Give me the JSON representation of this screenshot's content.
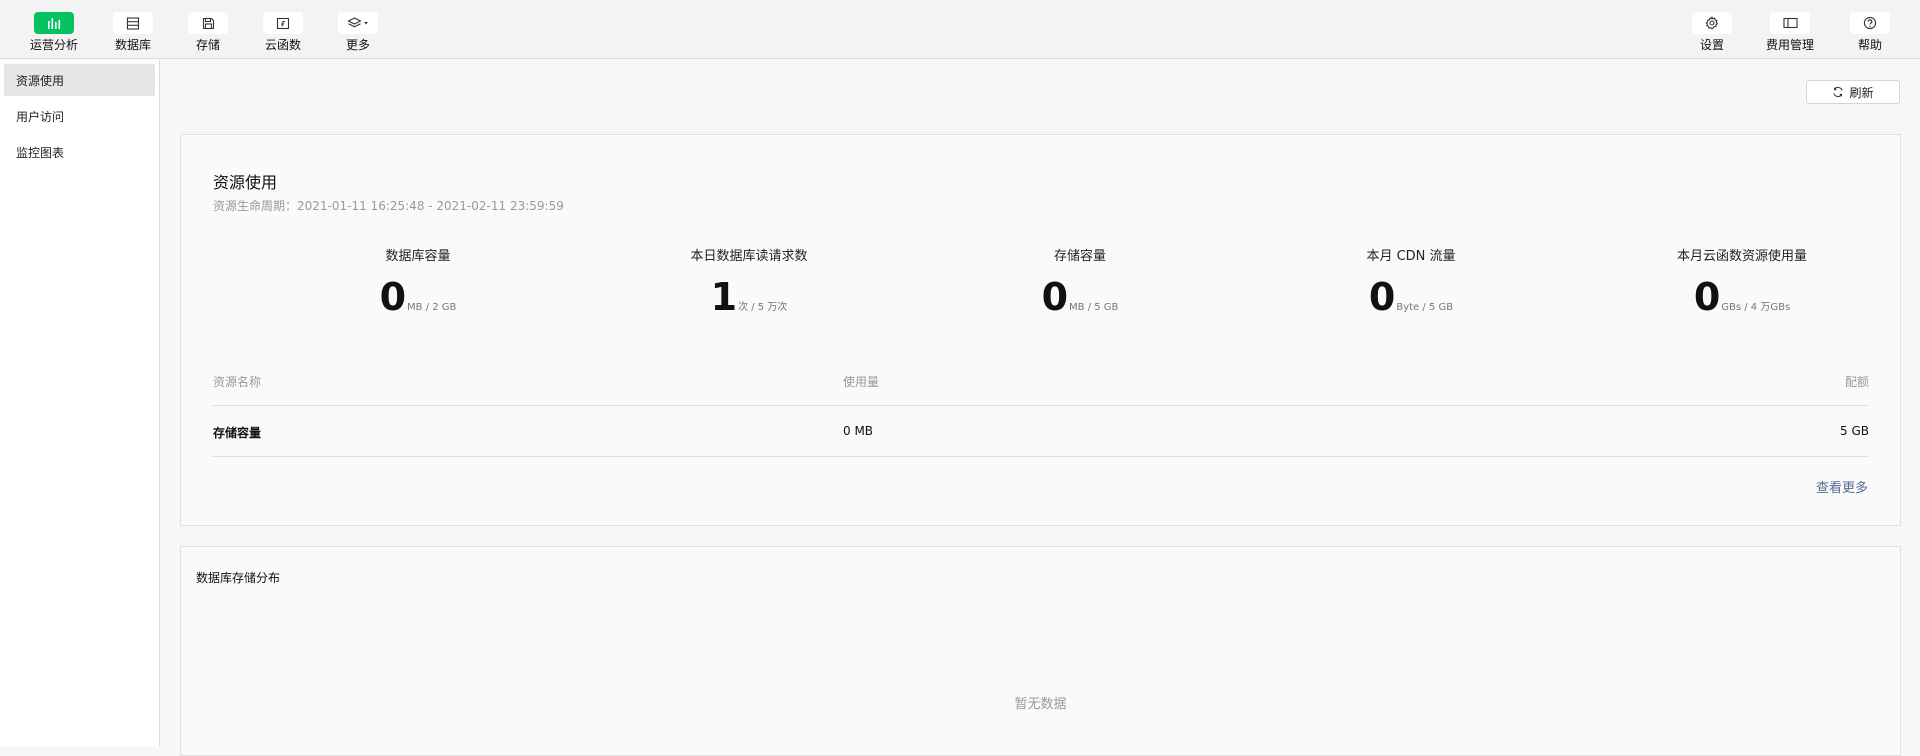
{
  "toolbar": {
    "left": [
      {
        "label": "运营分析",
        "icon": "chart-bar-icon",
        "active": true
      },
      {
        "label": "数据库",
        "icon": "database-icon",
        "active": false
      },
      {
        "label": "存储",
        "icon": "storage-icon",
        "active": false
      },
      {
        "label": "云函数",
        "icon": "function-icon",
        "active": false
      },
      {
        "label": "更多",
        "icon": "layers-icon",
        "active": false
      }
    ],
    "right": [
      {
        "label": "设置",
        "icon": "gear-icon"
      },
      {
        "label": "费用管理",
        "icon": "billing-icon"
      },
      {
        "label": "帮助",
        "icon": "help-icon"
      }
    ],
    "accent": "#07c160"
  },
  "sidebar": {
    "items": [
      {
        "label": "资源使用",
        "active": true
      },
      {
        "label": "用户访问",
        "active": false
      },
      {
        "label": "监控图表",
        "active": false
      }
    ]
  },
  "main": {
    "refresh_label": "刷新",
    "resource_card": {
      "title": "资源使用",
      "lifecycle": "资源生命周期：2021-01-11 16:25:48 - 2021-02-11 23:59:59",
      "stats": [
        {
          "label": "数据库容量",
          "value": "0",
          "unit": "MB / 2 GB"
        },
        {
          "label": "本日数据库读请求数",
          "value": "1",
          "unit": "次 / 5 万次"
        },
        {
          "label": "存储容量",
          "value": "0",
          "unit": "MB / 5 GB"
        },
        {
          "label": "本月 CDN 流量",
          "value": "0",
          "unit": "Byte / 5 GB"
        },
        {
          "label": "本月云函数资源使用量",
          "value": "0",
          "unit": "GBs / 4 万GBs"
        }
      ],
      "table": {
        "headers": [
          "资源名称",
          "使用量",
          "配额"
        ],
        "rows": [
          [
            "存储容量",
            "0 MB",
            "5 GB"
          ]
        ]
      },
      "more_link": "查看更多"
    },
    "db_card": {
      "title": "数据库存储分布",
      "empty_text": "暂无数据"
    }
  }
}
